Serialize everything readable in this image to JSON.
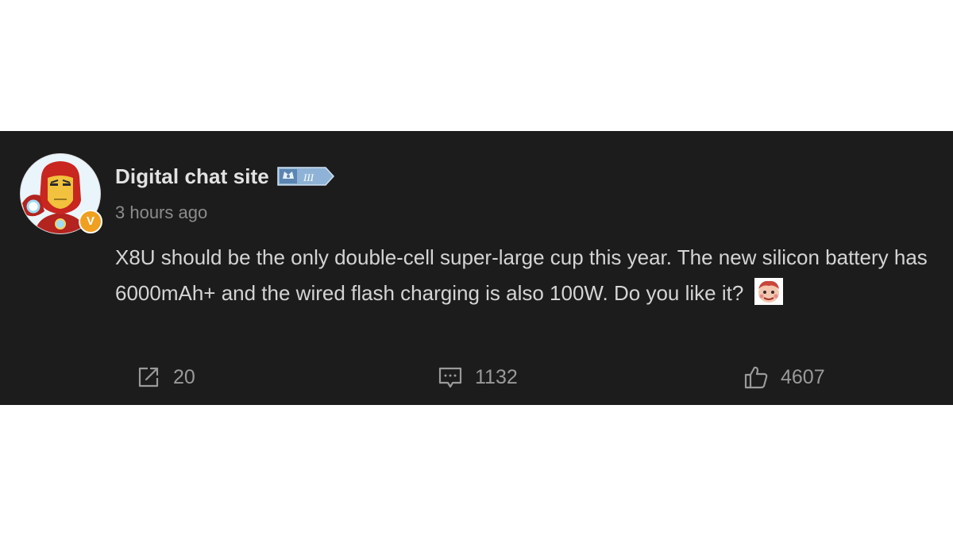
{
  "post": {
    "author": {
      "name": "Digital chat site",
      "verified_mark": "V",
      "level_badge_text": "III",
      "avatar_icon": "iron-man-avatar"
    },
    "timestamp": "3 hours ago",
    "body_text": "X8U should be the only double-cell super-large cup this year. The new silicon battery has 6000mAh+ and the wired flash charging is also 100W. Do you like it?",
    "body_emoji": "sticker-emoji",
    "actions": {
      "share": {
        "icon": "share-icon",
        "count": "20"
      },
      "comment": {
        "icon": "comment-icon",
        "count": "1132"
      },
      "like": {
        "icon": "thumbs-up-icon",
        "count": "4607"
      }
    }
  },
  "colors": {
    "card_background": "#1c1c1c",
    "page_background": "#ffffff",
    "name_text": "#e2e2e2",
    "body_text": "#d4d4d4",
    "muted_text": "#8c8c8c",
    "verified_badge": "#f0a020"
  }
}
